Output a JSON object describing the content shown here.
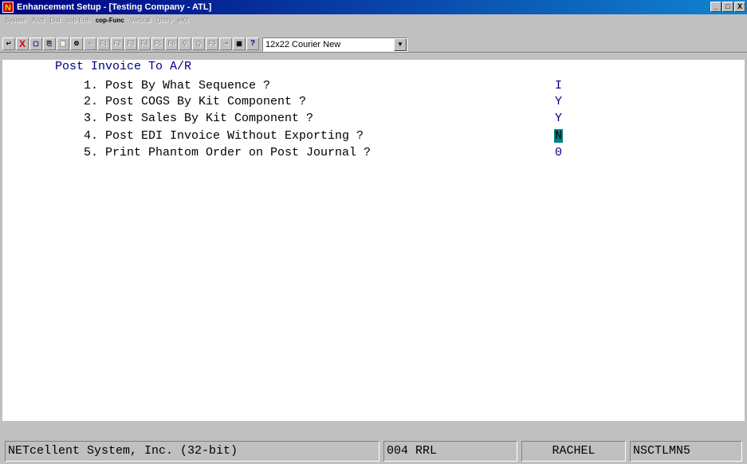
{
  "window": {
    "title": "Enhancement Setup - [Testing Company - ATL]",
    "app_icon_letter": "N",
    "buttons": [
      "_",
      "□",
      "X"
    ]
  },
  "menu": {
    "items": [
      "System",
      "Acct",
      "Dist",
      "cop-Enh",
      "cop-Func",
      "Vertical",
      "Utility",
      "eXit"
    ],
    "active": "cop-Func"
  },
  "toolbar": {
    "buttons": [
      {
        "icon": "enter-icon",
        "glyph": "↵"
      },
      {
        "icon": "cancel-icon",
        "glyph": "X"
      },
      {
        "icon": "select-icon",
        "glyph": "▢"
      },
      {
        "icon": "copy-icon",
        "glyph": "⎘"
      },
      {
        "icon": "paste-icon",
        "glyph": "📋"
      },
      {
        "icon": "settings-icon",
        "glyph": "⚙"
      },
      {
        "icon": "document-icon",
        "glyph": "≡"
      },
      {
        "icon": "f1-key",
        "glyph": "F1"
      },
      {
        "icon": "f2-key",
        "glyph": "F2"
      },
      {
        "icon": "f3-key",
        "glyph": "F3"
      },
      {
        "icon": "f4-key",
        "glyph": "F4"
      },
      {
        "icon": "f5-key",
        "glyph": "F5"
      },
      {
        "icon": "f6-key",
        "glyph": "F6"
      },
      {
        "icon": "binoculars-icon",
        "glyph": "⚲"
      },
      {
        "icon": "zoom-icon",
        "glyph": "Q"
      },
      {
        "icon": "f9-key",
        "glyph": "F9"
      },
      {
        "icon": "export-icon",
        "glyph": "⇥"
      },
      {
        "icon": "calculator-icon",
        "glyph": "▦"
      },
      {
        "icon": "help-icon",
        "glyph": "?"
      }
    ],
    "font_select": "12x22 Courier New"
  },
  "form": {
    "heading": "Post Invoice To A/R",
    "fields": [
      {
        "label": "1. Post By What Sequence ?",
        "value": "I"
      },
      {
        "label": "2. Post COGS By Kit Component ?",
        "value": "Y"
      },
      {
        "label": "3. Post Sales By Kit Component ?",
        "value": "Y"
      },
      {
        "label": "4. Post EDI Invoice Without Exporting ?",
        "value": "N"
      },
      {
        "label": "5. Print Phantom Order on Post Journal ?",
        "value": "0"
      }
    ]
  },
  "status": {
    "company": "NETcellent System, Inc. (32-bit)",
    "code": "004 RRL",
    "user": "RACHEL",
    "program": "NSCTLMN5"
  }
}
